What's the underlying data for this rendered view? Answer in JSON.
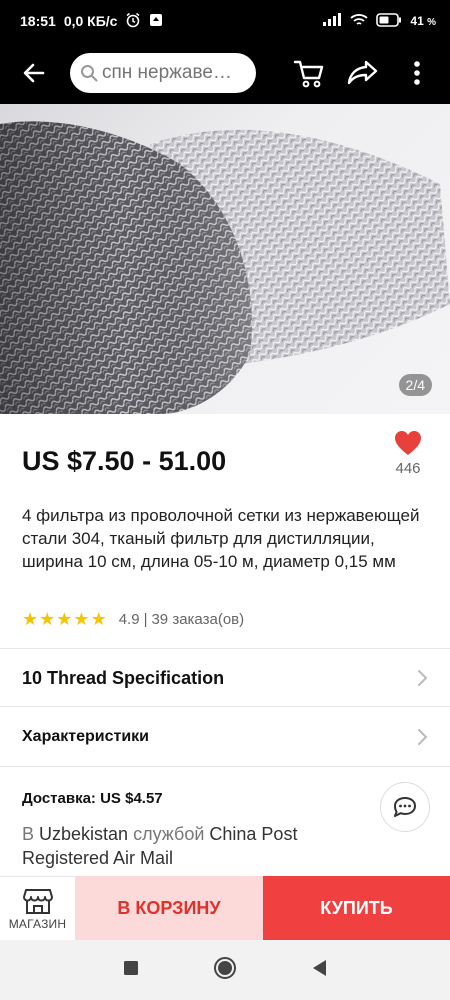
{
  "status_bar": {
    "time": "18:51",
    "network_speed": "0,0 КБ/с",
    "battery": "41",
    "battery_unit": "%",
    "icons": [
      "alarm-icon",
      "notification-icon",
      "signal-icon",
      "wifi-icon",
      "battery-icon"
    ]
  },
  "app_bar": {
    "search_placeholder": "спн нержаве…",
    "icons": [
      "back-arrow-icon",
      "search-icon",
      "cart-icon",
      "share-icon",
      "more-vert-icon"
    ]
  },
  "gallery": {
    "counter": "2/4"
  },
  "product": {
    "price": "US $7.50 - 51.00",
    "wishlist_count": "446",
    "title": "4 фильтра из проволочной сетки из нержавеющей стали 304, тканый фильтр для дистилляции, ширина 10 см, длина 05-10 м, диаметр 0,15 мм",
    "rating": "4.9",
    "rating_stars": 5,
    "orders": "39 заказа(ов)"
  },
  "specification_row": {
    "label": "10 Thread Specification"
  },
  "characteristics_row": {
    "label": "Характеристики"
  },
  "shipping": {
    "label": "Доставка: US $4.57",
    "desc_prefix": "В ",
    "country": "Uzbekistan",
    "desc_middle": " службой ",
    "carrier": "China Post Registered Air Mail"
  },
  "actions": {
    "store_label": "МАГАЗИН",
    "cart_label": "В КОРЗИНУ",
    "buy_label": "КУПИТЬ"
  },
  "colors": {
    "accent_red": "#f14040",
    "cart_bg": "#fddada",
    "cart_text": "#e0312b",
    "star": "#f6c500",
    "heart": "#e8403b"
  }
}
